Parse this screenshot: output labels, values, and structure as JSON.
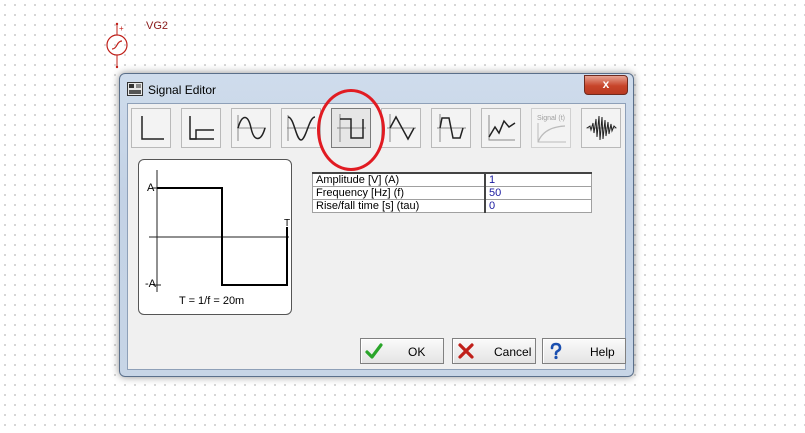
{
  "schematic": {
    "generator_label": "VG2"
  },
  "dialog": {
    "title": "Signal Editor",
    "close_glyph": "x",
    "waveform_buttons": [
      {
        "name": "unit-step",
        "label": ""
      },
      {
        "name": "step",
        "label": ""
      },
      {
        "name": "sine",
        "label": ""
      },
      {
        "name": "cosine",
        "label": ""
      },
      {
        "name": "square",
        "label": "",
        "selected": true
      },
      {
        "name": "triangle",
        "label": ""
      },
      {
        "name": "trapezoid",
        "label": ""
      },
      {
        "name": "piecewise-linear",
        "label": ""
      },
      {
        "name": "general-signal",
        "label": "Signal (t)",
        "disabled": true
      },
      {
        "name": "noise-burst",
        "label": ""
      }
    ],
    "preview": {
      "amp_label": "A",
      "neg_amp_label": "-A",
      "period_label": "T",
      "formula": "T = 1/f = 20m"
    },
    "params": [
      {
        "name": "Amplitude [V] (A)",
        "value": "1"
      },
      {
        "name": "Frequency [Hz] (f)",
        "value": "50"
      },
      {
        "name": "Rise/fall time [s] (tau)",
        "value": "0"
      }
    ],
    "buttons": {
      "ok": "OK",
      "cancel": "Cancel",
      "help": "Help"
    }
  },
  "colors": {
    "highlight": "#e11b22",
    "ok_icon": "#2aa52a",
    "cancel_icon": "#c0201a",
    "help_icon": "#1a4fb0",
    "schematic_label": "#8b1a1a"
  }
}
